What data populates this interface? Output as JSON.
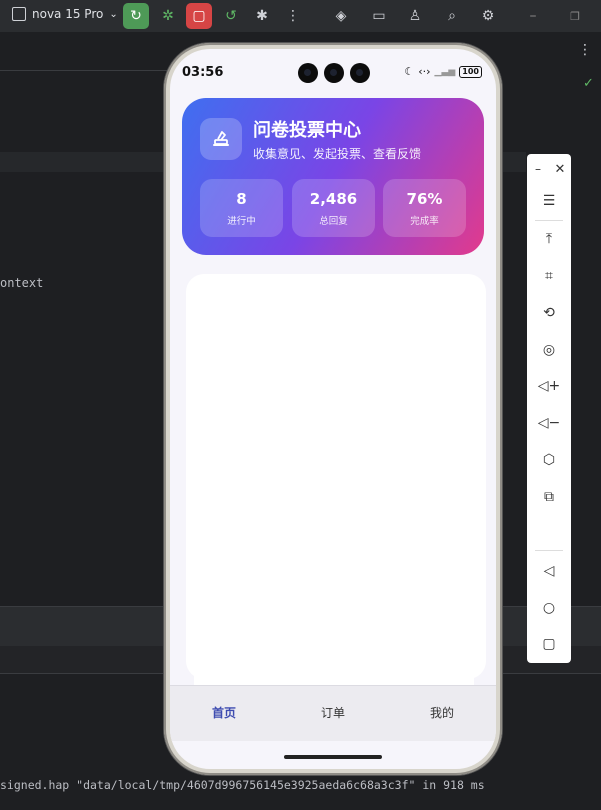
{
  "ide": {
    "device_name": "nova 15 Pro",
    "code_fragment": "ontext",
    "console_log": "signed.hap \"data/local/tmp/4607d996756145e3925aeda6c68a3c3f\" in 918 ms"
  },
  "phone": {
    "status_time": "03:56",
    "battery": "100"
  },
  "hero": {
    "title": "问卷投票中心",
    "subtitle": "收集意见、发起投票、查看反馈",
    "stats": [
      {
        "value": "8",
        "label": "进行中"
      },
      {
        "value": "2,486",
        "label": "总回复"
      },
      {
        "value": "76%",
        "label": "完成率"
      }
    ]
  },
  "tabs": [
    {
      "label": "首页",
      "active": true
    },
    {
      "label": "订单",
      "active": false
    },
    {
      "label": "我的",
      "active": false
    }
  ],
  "colors": {
    "gradient_start": "#3f6ff0",
    "gradient_mid": "#7a45e6",
    "gradient_end": "#e23a8c",
    "tab_active": "#3e4cb0",
    "run_green": "#4e9a57",
    "stop_red": "#d64545"
  },
  "icons": {
    "toolbar": [
      "device-icon",
      "run-icon",
      "bug-icon",
      "stop-icon",
      "rerun-icon",
      "debug-icon",
      "more-icon",
      "target-icon",
      "folder-icon",
      "user-icon",
      "search-icon",
      "settings-icon",
      "minimize-icon",
      "restore-icon"
    ],
    "emulator": [
      "minimize-icon",
      "close-icon",
      "menu-icon",
      "top-icon",
      "crop-icon",
      "rotate-icon",
      "screenshot-icon",
      "volume-up-icon",
      "volume-down-icon",
      "shake-icon",
      "multi-device-icon",
      "back-icon",
      "home-icon",
      "recent-icon"
    ]
  }
}
